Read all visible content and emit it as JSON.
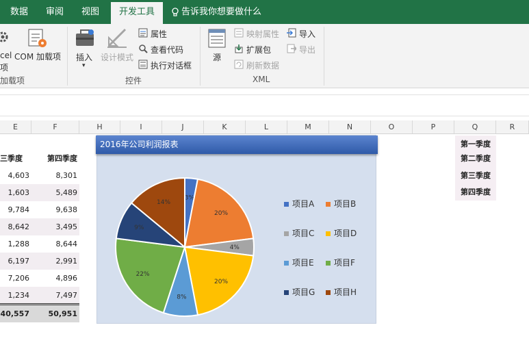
{
  "tabs": [
    {
      "label": "数据",
      "active": false
    },
    {
      "label": "审阅",
      "active": false
    },
    {
      "label": "视图",
      "active": false
    },
    {
      "label": "开发工具",
      "active": true
    }
  ],
  "tell_me": "告诉我你想要做什么",
  "ribbon": {
    "addins": {
      "excel_label_a": "cel",
      "excel_label_b": "项",
      "com_label": "COM 加载项",
      "group_label": "加载项"
    },
    "controls": {
      "insert": "插入",
      "design_mode": "设计模式",
      "properties": "属性",
      "view_code": "查看代码",
      "run_dialog": "执行对话框",
      "group_label": "控件"
    },
    "xml": {
      "source": "源",
      "map_properties": "映射属性",
      "expansion_packs": "扩展包",
      "refresh_data": "刷新数据",
      "import": "导入",
      "export": "导出",
      "group_label": "XML"
    }
  },
  "columns": [
    "E",
    "F",
    "H",
    "I",
    "J",
    "K",
    "L",
    "M",
    "N",
    "O",
    "P",
    "Q",
    "R"
  ],
  "table": {
    "headers": [
      "三季度",
      "第四季度"
    ],
    "rows": [
      [
        "4,603",
        "8,301"
      ],
      [
        "1,603",
        "5,489"
      ],
      [
        "9,784",
        "9,638"
      ],
      [
        "8,642",
        "3,495"
      ],
      [
        "1,288",
        "8,644"
      ],
      [
        "6,197",
        "2,991"
      ],
      [
        "7,206",
        "4,896"
      ],
      [
        "1,234",
        "7,497"
      ]
    ],
    "totals": [
      "40,557",
      "50,951"
    ]
  },
  "quarter_list": [
    "第一季度",
    "第二季度",
    "第三季度",
    "第四季度"
  ],
  "chart_data": {
    "type": "pie",
    "title": "2016年公司利润报表",
    "categories": [
      "项目A",
      "项目B",
      "项目C",
      "项目D",
      "项目E",
      "项目F",
      "项目G",
      "项目H"
    ],
    "values": [
      3,
      20,
      4,
      20,
      8,
      22,
      9,
      14
    ],
    "labels": [
      "3%",
      "20%",
      "4%",
      "20%",
      "8%",
      "22%",
      "9%",
      "14%"
    ],
    "colors": [
      "#4472c4",
      "#ed7d31",
      "#a5a5a5",
      "#ffc000",
      "#5b9bd5",
      "#70ad47",
      "#264478",
      "#9e480e"
    ],
    "legend_position": "right",
    "background": "#d5dfee"
  }
}
